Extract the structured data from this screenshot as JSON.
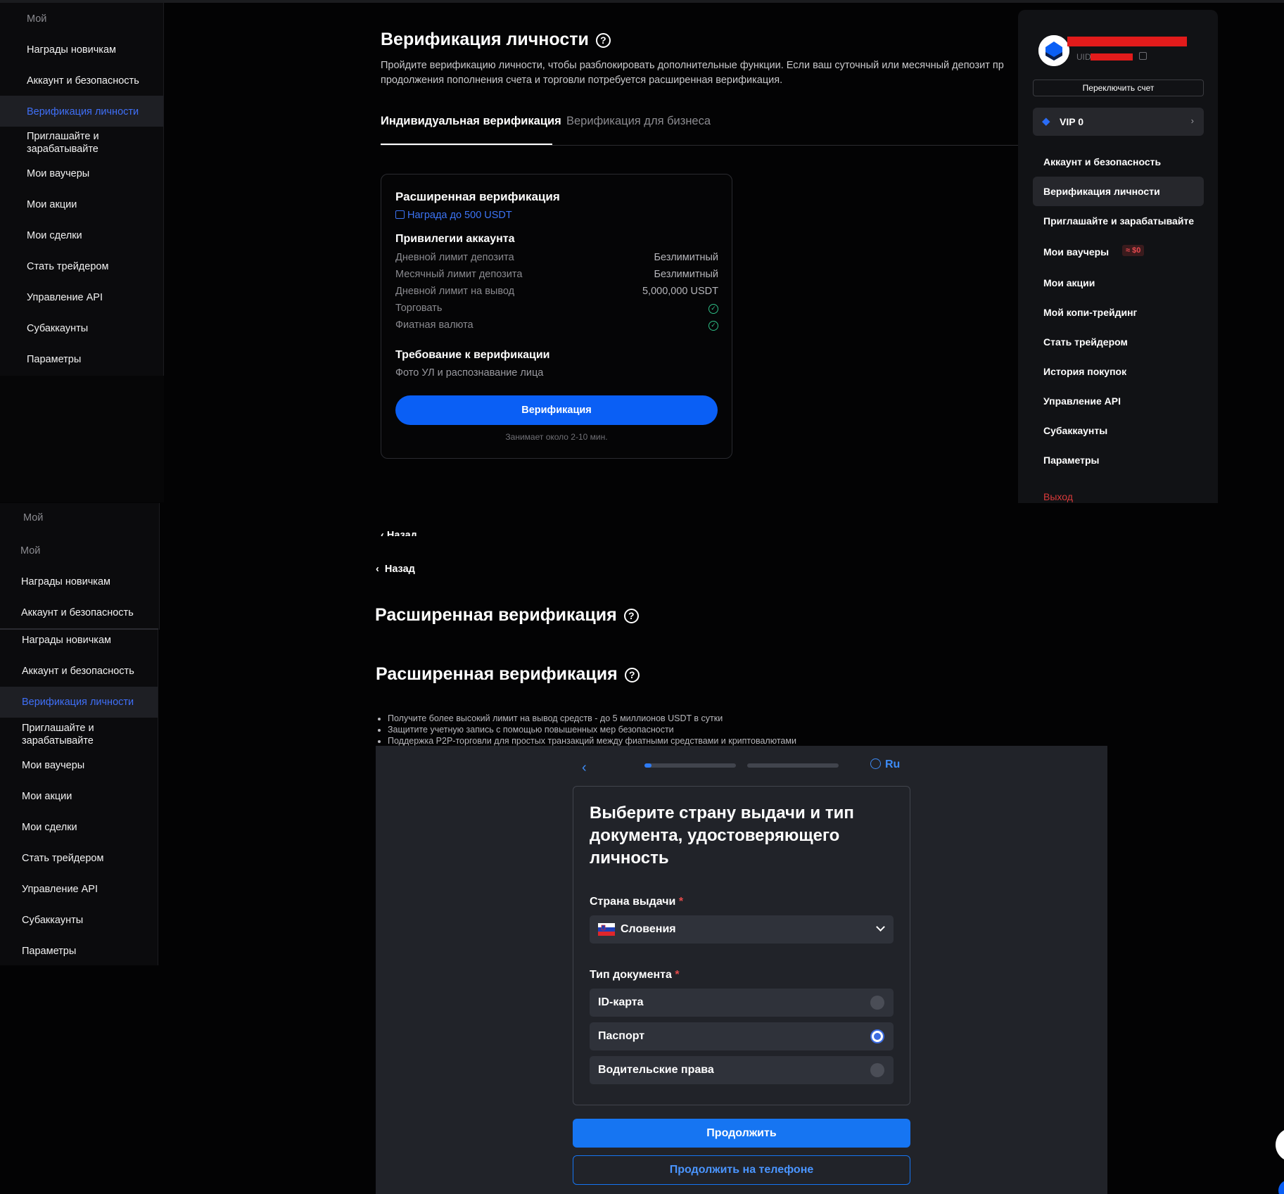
{
  "sidebar_top": {
    "heading": "Мой",
    "items": [
      {
        "label": "Награды новичкам"
      },
      {
        "label": "Аккаунт и безопасность"
      },
      {
        "label": "Верификация личности"
      },
      {
        "label": "Приглашайте и зарабатывайте"
      },
      {
        "label": "Мои ваучеры"
      },
      {
        "label": "Мои акции"
      },
      {
        "label": "Мои сделки"
      },
      {
        "label": "Стать трейдером"
      },
      {
        "label": "Управление API"
      },
      {
        "label": "Субаккаунты"
      },
      {
        "label": "Параметры"
      }
    ]
  },
  "sidebar_mid": {
    "heading1": "Мой",
    "heading2": "Мой",
    "items": [
      {
        "label": "Награды новичкам"
      },
      {
        "label": "Аккаунт и безопасность"
      }
    ]
  },
  "sidebar_bottom": {
    "items": [
      {
        "label": "Награды новичкам"
      },
      {
        "label": "Аккаунт и безопасность"
      },
      {
        "label": "Верификация личности"
      },
      {
        "label": "Приглашайте и зарабатывайте"
      },
      {
        "label": "Мои ваучеры"
      },
      {
        "label": "Мои акции"
      },
      {
        "label": "Мои сделки"
      },
      {
        "label": "Стать трейдером"
      },
      {
        "label": "Управление API"
      },
      {
        "label": "Субаккаунты"
      },
      {
        "label": "Параметры"
      }
    ]
  },
  "main": {
    "title": "Верификация личности",
    "help_icon": "?",
    "description_line1": "Пройдите верификацию личности, чтобы разблокировать дополнительные функции. Если ваш суточный или месячный депозит пр",
    "description_line2": "продолжения пополнения счета и торговли потребуется расширенная верификация.",
    "tabs": [
      {
        "label": "Индивидуальная верификация",
        "active": true
      },
      {
        "label": "Верификация для бизнеса",
        "active": false
      }
    ]
  },
  "card": {
    "title": "Расширенная верификация",
    "reward": "Награда до 500 USDT",
    "privileges_title": "Привилегии аккаунта",
    "privileges": [
      {
        "label": "Дневной лимит депозита",
        "value": "Безлимитный"
      },
      {
        "label": "Месячный лимит депозита",
        "value": "Безлимитный"
      },
      {
        "label": "Дневной лимит на вывод",
        "value": "5,000,000 USDT"
      },
      {
        "label": "Торговать",
        "value": "check"
      },
      {
        "label": "Фиатная валюта",
        "value": "check"
      }
    ],
    "requirement_title": "Требование к верификации",
    "requirement_text": "Фото УЛ и распознавание лица",
    "button": "Верификация",
    "duration": "Занимает около 2-10 мин."
  },
  "right_panel": {
    "uid_label": "UID",
    "switch_account": "Переключить счет",
    "vip": "VIP 0",
    "items": [
      {
        "label": "Аккаунт и безопасность"
      },
      {
        "label": "Верификация личности"
      },
      {
        "label": "Приглашайте и зарабатывайте"
      },
      {
        "label": "Мои ваучеры"
      },
      {
        "label": "Мои акции"
      },
      {
        "label": "Мой копи-трейдинг"
      },
      {
        "label": "Стать трейдером"
      },
      {
        "label": "История покупок"
      },
      {
        "label": "Управление API"
      },
      {
        "label": "Субаккаунты"
      },
      {
        "label": "Параметры"
      }
    ],
    "voucher_badge": "≈ $0",
    "logout": "Выход"
  },
  "lower": {
    "back_partial": "‹ Назад",
    "back": "Назад",
    "title_a": "Расширенная верификация",
    "title_b": "Расширенная верификация",
    "bullets": [
      "Получите более высокий лимит на вывод средств - до 5 миллионов USDT в сутки",
      "Защитите учетную запись с помощью повышенных мер безопасности",
      "Поддержка P2P-торговли для простых транзакций между фиатными средствами и криптовалютами"
    ]
  },
  "sumsub": {
    "lang": "Ru",
    "progress_fraction": 0.08,
    "title": "Выберите страну выдачи и тип документа, удостоверяющего личность",
    "country_label": "Страна выдачи",
    "required_mark": "*",
    "country_value": "Словения",
    "doc_label": "Тип документа",
    "doc_options": [
      {
        "label": "ID-карта",
        "selected": false
      },
      {
        "label": "Паспорт",
        "selected": true
      },
      {
        "label": "Водительские права",
        "selected": false
      }
    ],
    "continue": "Продолжить",
    "continue_phone": "Продолжить на телефоне"
  },
  "colors": {
    "accent_blue": "#0a5ff5",
    "link_blue": "#3f6ff7",
    "success": "#2ebd85",
    "danger": "#e21b1b"
  }
}
